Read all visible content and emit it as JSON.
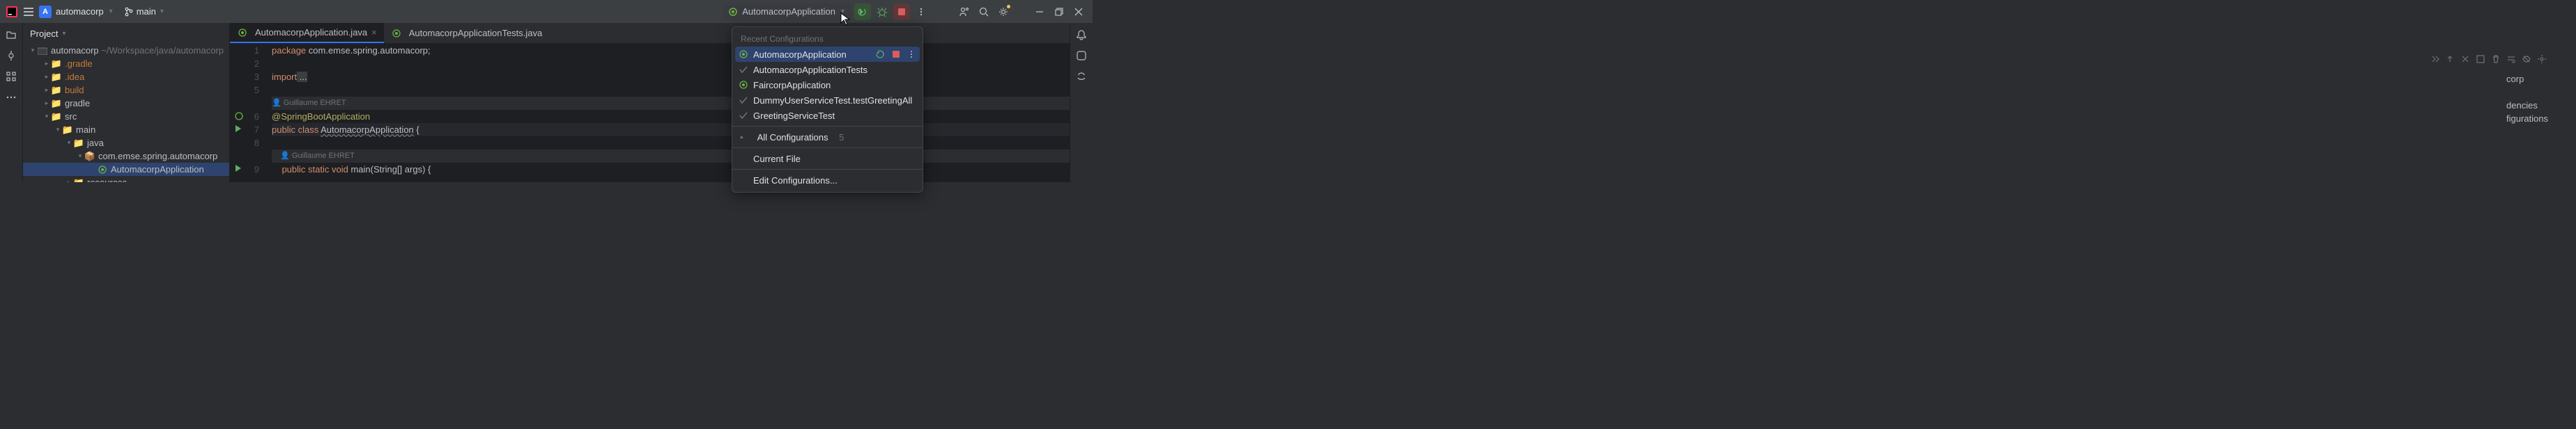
{
  "titlebar": {
    "project_badge": "A",
    "project_name": "automacorp",
    "branch": "main",
    "run_config_selected": "AutomacorpApplication"
  },
  "popup": {
    "header": "Recent Configurations",
    "items": [
      {
        "label": "AutomacorpApplication",
        "kind": "spring",
        "selected": true
      },
      {
        "label": "AutomacorpApplicationTests",
        "kind": "test",
        "selected": false
      },
      {
        "label": "FaircorpApplication",
        "kind": "spring",
        "selected": false
      },
      {
        "label": "DummyUserServiceTest.testGreetingAll",
        "kind": "test",
        "selected": false
      },
      {
        "label": "GreetingServiceTest",
        "kind": "test",
        "selected": false
      }
    ],
    "all_configs": "All Configurations",
    "all_count": "5",
    "current_file": "Current File",
    "edit": "Edit Configurations..."
  },
  "project": {
    "header": "Project",
    "tree": {
      "root": "automacorp",
      "root_path": "~/Workspace/java/automacorp",
      "n_gradle_dot": ".gradle",
      "n_idea": ".idea",
      "n_build": "build",
      "n_gradle": "gradle",
      "n_src": "src",
      "n_main": "main",
      "n_java": "java",
      "n_pkg": "com.emse.spring.automacorp",
      "n_app": "AutomacorpApplication",
      "n_resources": "resources"
    }
  },
  "tabs": [
    {
      "label": "AutomacorpApplication.java",
      "active": true,
      "icon": "spring"
    },
    {
      "label": "AutomacorpApplicationTests.java",
      "active": false,
      "icon": "spring"
    }
  ],
  "code": {
    "author1": "Guillaume EHRET",
    "author2": "Guillaume EHRET",
    "l1_kw": "package",
    "l1_rest": " com.emse.spring.automacorp;",
    "l3_kw": "import",
    "l3_rest": " ...",
    "l6": "@SpringBootApplication",
    "l7_pub": "public ",
    "l7_cls": "class ",
    "l7_name": "AutomacorpApplication",
    "l7_brace": " {",
    "l9_ind": "    ",
    "l9_pub": "public ",
    "l9_stat": "static ",
    "l9_void": "void ",
    "l9_main": "main",
    "l9_args": "(String[] args) {"
  },
  "line_numbers": [
    "1",
    "2",
    "3",
    "5",
    "",
    "6",
    "7",
    "8",
    "",
    "9"
  ],
  "right_text": {
    "corp": "corp",
    "dencies": "dencies",
    "figurations": "figurations"
  }
}
